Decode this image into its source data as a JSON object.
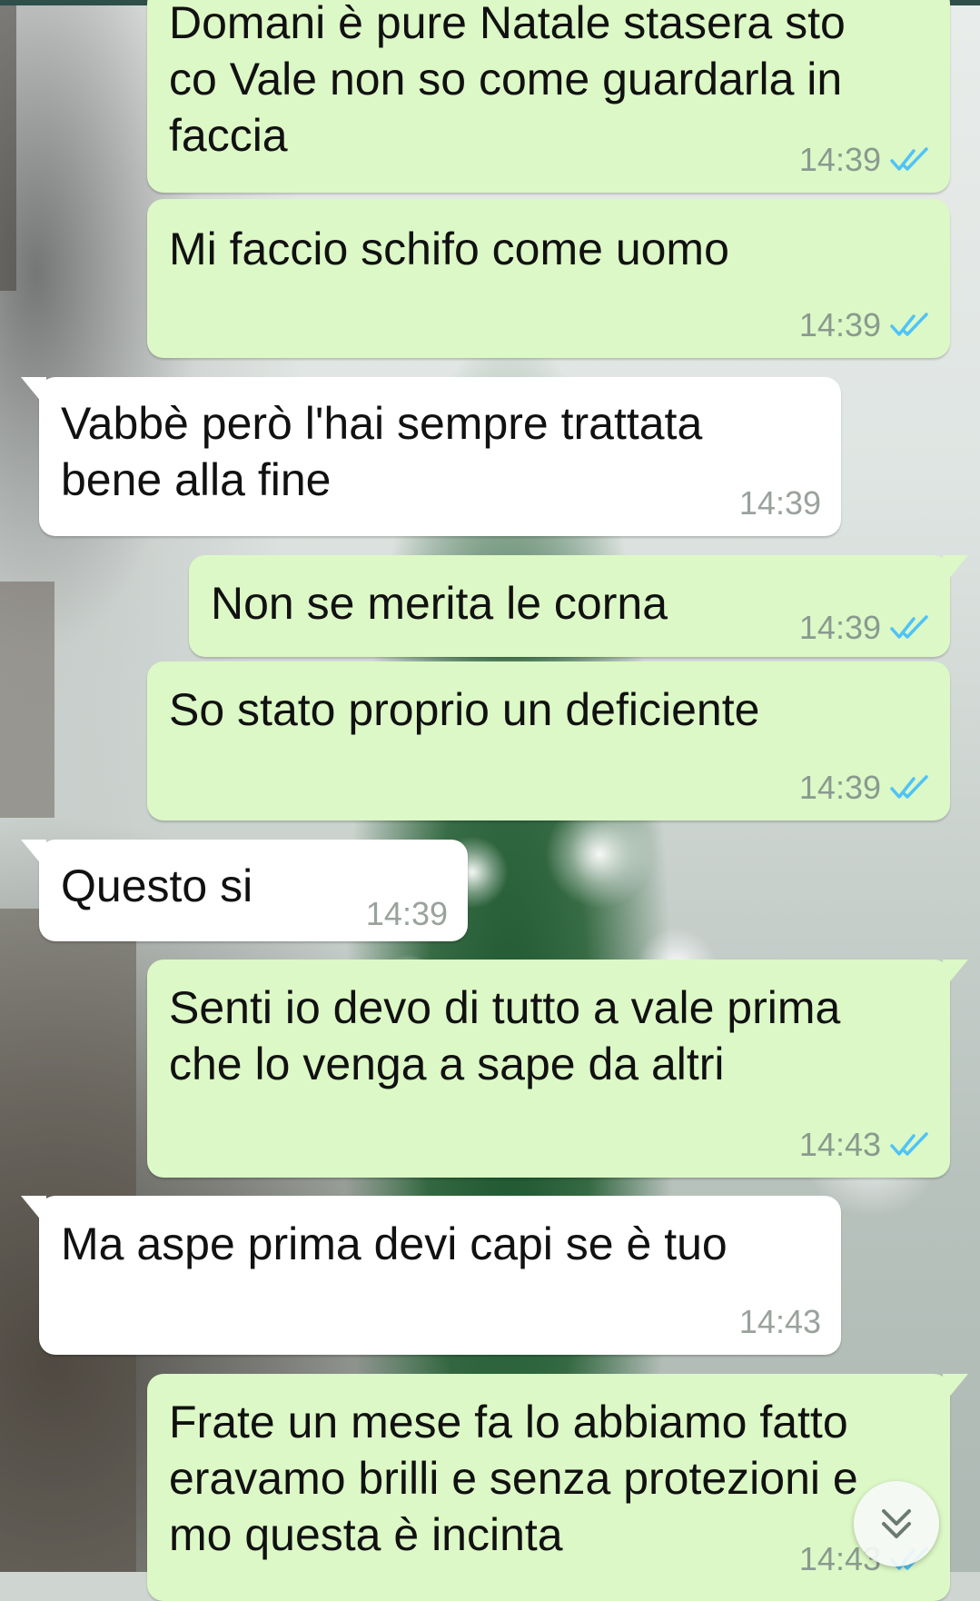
{
  "chat": {
    "messages": [
      {
        "direction": "out",
        "text": "Domani è pure Natale stasera sto\nco Vale non so come guardarla in\nfaccia",
        "time": "14:39",
        "status": "read"
      },
      {
        "direction": "out",
        "text": "Mi faccio schifo come uomo",
        "time": "14:39",
        "status": "read"
      },
      {
        "direction": "in",
        "text": "Vabbè però l'hai sempre trattata\nbene alla fine",
        "time": "14:39"
      },
      {
        "direction": "out",
        "text": "Non se merita le corna",
        "time": "14:39",
        "status": "read"
      },
      {
        "direction": "out",
        "text": "So stato proprio un deficiente",
        "time": "14:39",
        "status": "read"
      },
      {
        "direction": "in",
        "text": "Questo si",
        "time": "14:39"
      },
      {
        "direction": "out",
        "text": "Senti io devo di tutto a vale prima\nche lo venga a sape da altri",
        "time": "14:43",
        "status": "read"
      },
      {
        "direction": "in",
        "text": "Ma aspe prima devi capi se è tuo",
        "time": "14:43"
      },
      {
        "direction": "out",
        "text": "Frate un mese fa lo abbiamo fatto\neravamo brilli e senza protezioni e\nmo questa è incinta",
        "time": "14:43",
        "status": "read"
      }
    ]
  },
  "colors": {
    "outgoing_bubble": "#dcf8c6",
    "incoming_bubble": "#ffffff",
    "read_ticks": "#4fc3f7",
    "timestamp": "#8a9a8f"
  },
  "icons": {
    "read_receipt": "double-check-icon",
    "scroll_down": "chevron-double-down-icon"
  }
}
